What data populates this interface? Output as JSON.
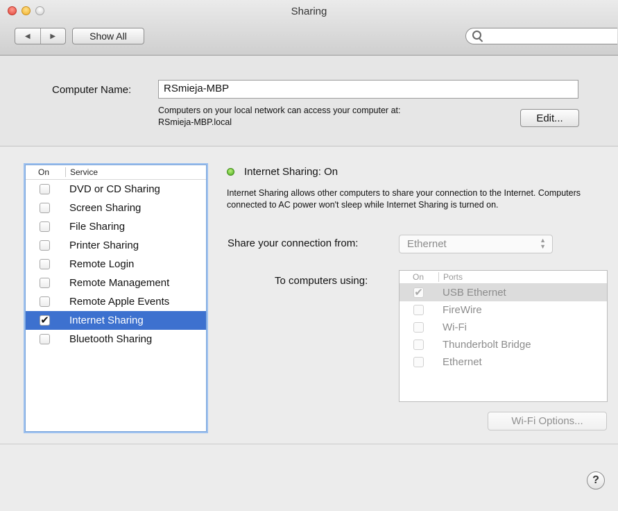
{
  "window": {
    "title": "Sharing"
  },
  "toolbar": {
    "back_glyph": "◀",
    "forward_glyph": "▶",
    "show_all_label": "Show All",
    "search_value": ""
  },
  "computer_name": {
    "label": "Computer Name:",
    "value": "RSmieja-MBP",
    "access_text": "Computers on your local network can access your computer at:",
    "local_address": "RSmieja-MBP.local",
    "edit_label": "Edit..."
  },
  "services": {
    "header_on": "On",
    "header_service": "Service",
    "items": [
      {
        "name": "DVD or CD Sharing",
        "checked": false,
        "selected": false
      },
      {
        "name": "Screen Sharing",
        "checked": false,
        "selected": false
      },
      {
        "name": "File Sharing",
        "checked": false,
        "selected": false
      },
      {
        "name": "Printer Sharing",
        "checked": false,
        "selected": false
      },
      {
        "name": "Remote Login",
        "checked": false,
        "selected": false
      },
      {
        "name": "Remote Management",
        "checked": false,
        "selected": false
      },
      {
        "name": "Remote Apple Events",
        "checked": false,
        "selected": false
      },
      {
        "name": "Internet Sharing",
        "checked": true,
        "selected": true
      },
      {
        "name": "Bluetooth Sharing",
        "checked": false,
        "selected": false
      }
    ]
  },
  "detail": {
    "status": "Internet Sharing: On",
    "status_color": "#4caa1e",
    "description": "Internet Sharing allows other computers to share your connection to the Internet. Computers connected to AC power won't sleep while Internet Sharing is turned on.",
    "share_from_label": "Share your connection from:",
    "share_from_value": "Ethernet",
    "to_computers_label": "To computers using:",
    "ports_header_on": "On",
    "ports_header_ports": "Ports",
    "ports": [
      {
        "name": "USB Ethernet",
        "checked": true,
        "selected": true
      },
      {
        "name": "FireWire",
        "checked": false,
        "selected": false
      },
      {
        "name": "Wi-Fi",
        "checked": false,
        "selected": false
      },
      {
        "name": "Thunderbolt Bridge",
        "checked": false,
        "selected": false
      },
      {
        "name": "Ethernet",
        "checked": false,
        "selected": false
      }
    ],
    "wifi_options_label": "Wi-Fi Options..."
  },
  "help": {
    "label": "?"
  },
  "colors": {
    "selection": "#3d71cf",
    "list_focus_ring": "#9cc0ef"
  }
}
